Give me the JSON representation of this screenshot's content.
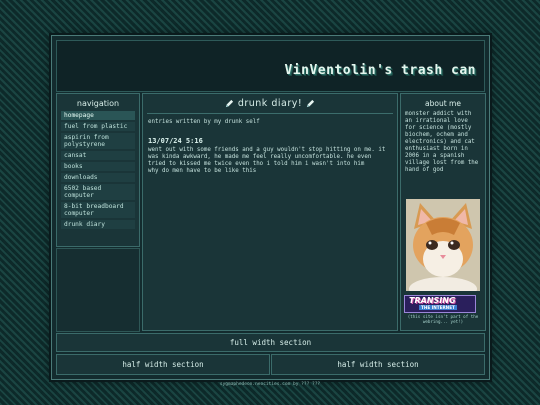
{
  "site": {
    "title": "VinVentolin's trash can"
  },
  "navigation": {
    "heading": "navigation",
    "items": [
      {
        "label": "homepage"
      },
      {
        "label": "fuel from plastic"
      },
      {
        "label": "aspirin from polystyrene"
      },
      {
        "label": "cansat"
      },
      {
        "label": "books"
      },
      {
        "label": "downloads"
      },
      {
        "label": "6502 based computer"
      },
      {
        "label": "8-bit breadboard computer"
      },
      {
        "label": "drunk diary"
      }
    ]
  },
  "main": {
    "heading": "drunk diary!",
    "icons": [
      "pencil-icon",
      "pencil-icon"
    ],
    "caption": "entries written by my drunk self",
    "entry": {
      "date": "13/07/24 5:16",
      "lines": [
        "went out with some friends and a guy wouldn't stop hitting on me. it was kinda awkward, he made me feel really uncomfortable. he even tried to kissed me twice even tho i told him i wasn't into him",
        "why do men have to be like this"
      ]
    }
  },
  "about": {
    "heading": "about me",
    "text": "monster addict with an irrational love for science (mostly biochem, ochem and electronics) and cat enthusiast born in 2006 in a spanish village lost from the hand of god",
    "badge": {
      "main": "TRANSING",
      "sub": "THE INTERNET"
    },
    "badge_note": "(this site isn't part of the webring... yet!)"
  },
  "sections": {
    "full": "full width section",
    "half_left": "half width section",
    "half_right": "half width section"
  },
  "footer": "sygmaphedeon.neocities.com by ??? ???"
}
